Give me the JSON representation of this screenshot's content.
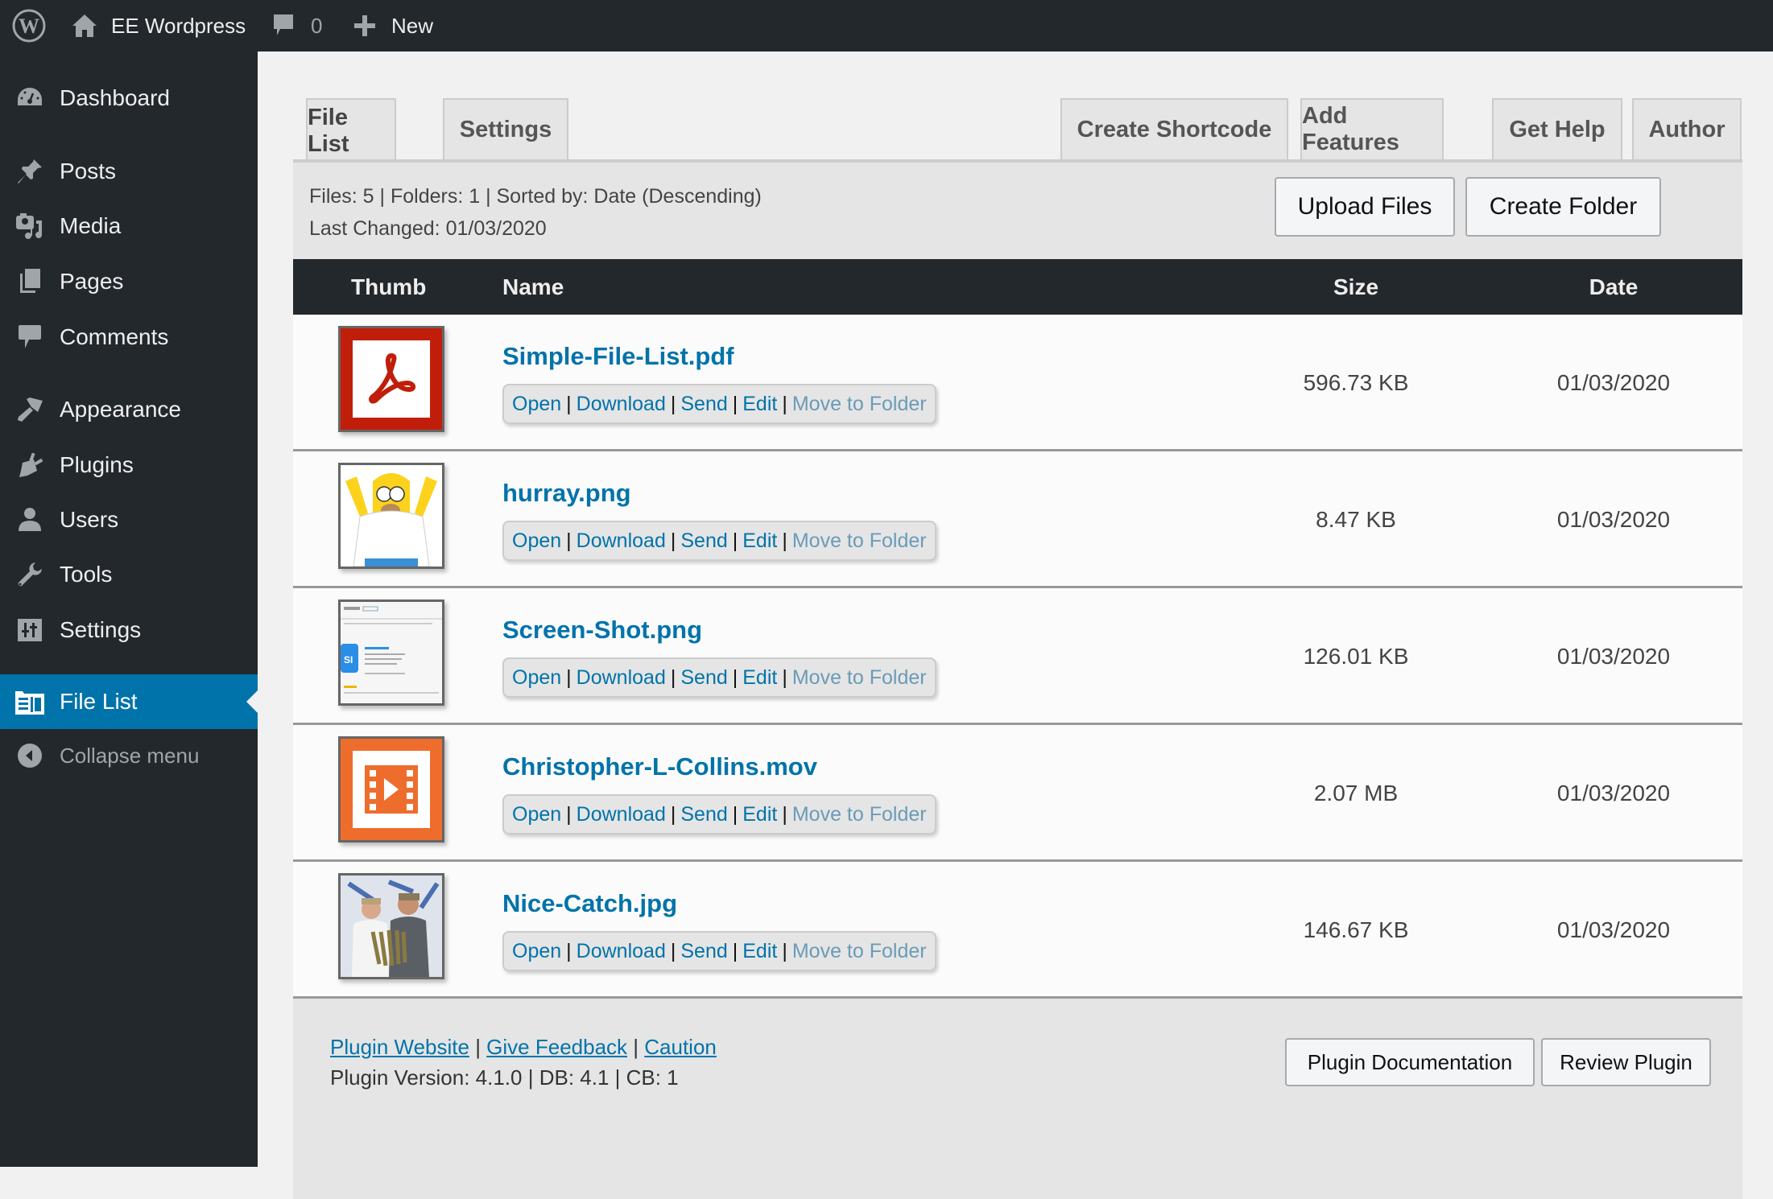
{
  "adminbar": {
    "site_name": "EE Wordpress",
    "comments_count": "0",
    "new_label": "New"
  },
  "sidebar": {
    "items": [
      {
        "label": "Dashboard",
        "icon": "dashboard-icon"
      },
      {
        "label": "Posts",
        "icon": "pin-icon"
      },
      {
        "label": "Media",
        "icon": "media-icon"
      },
      {
        "label": "Pages",
        "icon": "pages-icon"
      },
      {
        "label": "Comments",
        "icon": "comment-icon"
      },
      {
        "label": "Appearance",
        "icon": "paintbrush-icon"
      },
      {
        "label": "Plugins",
        "icon": "plugin-icon"
      },
      {
        "label": "Users",
        "icon": "user-icon"
      },
      {
        "label": "Tools",
        "icon": "wrench-icon"
      },
      {
        "label": "Settings",
        "icon": "settings-icon"
      },
      {
        "label": "File List",
        "icon": "file-list-icon",
        "active": true
      }
    ],
    "collapse_label": "Collapse menu"
  },
  "tabs": {
    "left": [
      "File List",
      "Settings"
    ],
    "right": [
      "Create Shortcode",
      "Add Features",
      "Get Help",
      "Author"
    ],
    "active": "File List"
  },
  "info": {
    "line1": "Files: 5 | Folders: 1 | Sorted by: Date (Descending)",
    "line2": "Last Changed: 01/03/2020"
  },
  "buttons": {
    "upload": "Upload Files",
    "create_folder": "Create Folder"
  },
  "table": {
    "headers": {
      "thumb": "Thumb",
      "name": "Name",
      "size": "Size",
      "date": "Date"
    },
    "actions": [
      "Open",
      "Download",
      "Send",
      "Edit",
      "Move to Folder"
    ],
    "rows": [
      {
        "name": "Simple-File-List.pdf",
        "size": "596.73 KB",
        "date": "01/03/2020",
        "thumb": "pdf-icon"
      },
      {
        "name": "hurray.png",
        "size": "8.47 KB",
        "date": "01/03/2020",
        "thumb": "image-thumbnail"
      },
      {
        "name": "Screen-Shot.png",
        "size": "126.01 KB",
        "date": "01/03/2020",
        "thumb": "screenshot-thumbnail"
      },
      {
        "name": "Christopher-L-Collins.mov",
        "size": "2.07 MB",
        "date": "01/03/2020",
        "thumb": "video-icon"
      },
      {
        "name": "Nice-Catch.jpg",
        "size": "146.67 KB",
        "date": "01/03/2020",
        "thumb": "photo-thumbnail"
      }
    ]
  },
  "footer": {
    "links": [
      "Plugin Website",
      "Give Feedback",
      "Caution"
    ],
    "version_line": "Plugin Version: 4.1.0 | DB: 4.1 | CB: 1",
    "doc_button": "Plugin Documentation",
    "review_button": "Review Plugin"
  },
  "colors": {
    "adminbar_bg": "#23282d",
    "accent": "#0073aa",
    "pdf_red": "#c01e0a",
    "video_orange": "#ee6d2c"
  }
}
